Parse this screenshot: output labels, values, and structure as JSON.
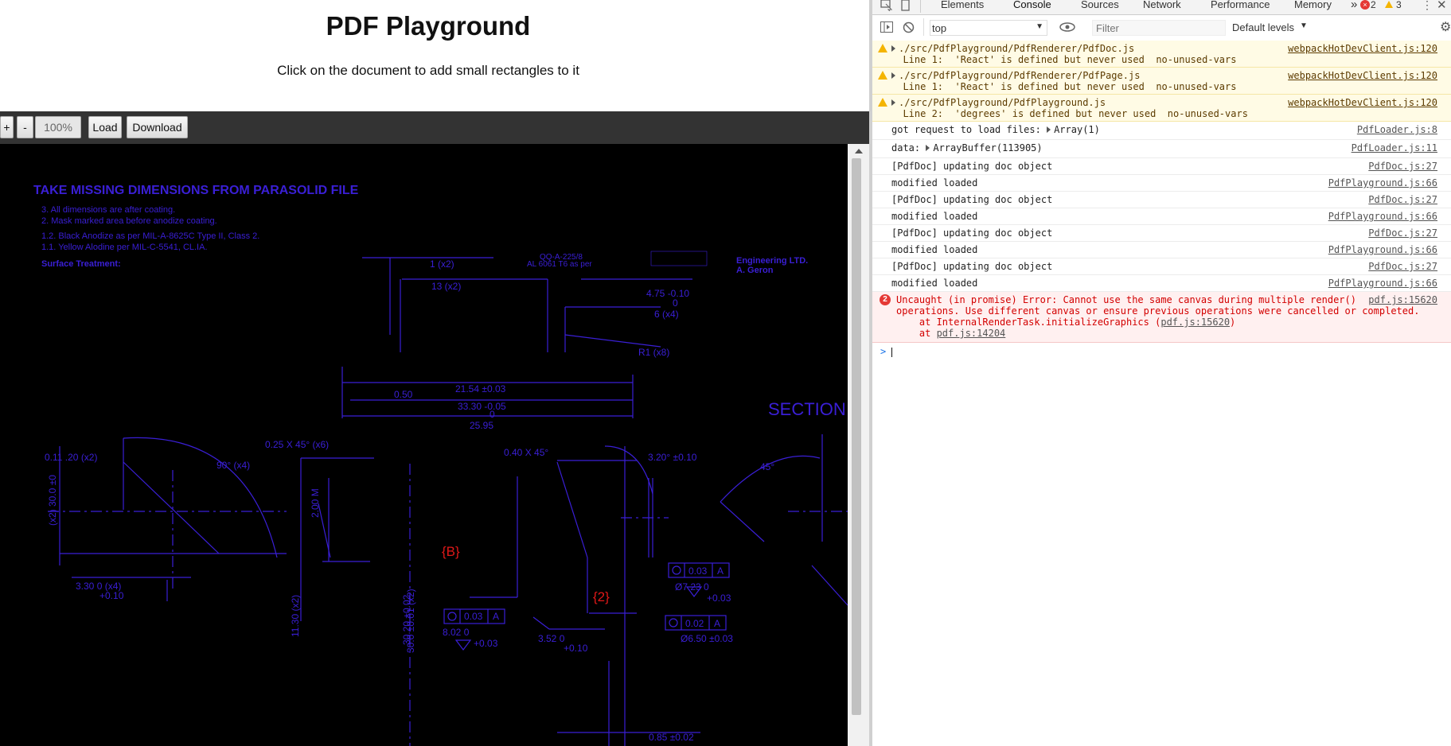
{
  "app": {
    "title": "PDF Playground",
    "subtitle": "Click on the document to add small rectangles to it",
    "toolbar": {
      "zoom_in": "+",
      "zoom_out": "-",
      "zoom_level": "100%",
      "load": "Load",
      "download": "Download"
    },
    "drawing": {
      "notes_title": "TAKE MISSING DIMENSIONS FROM PARASOLID FILE",
      "note_3": "3. All dimensions are after coating.",
      "note_2": "2. Mask marked area before anodize coating.",
      "note_1b": "1.2. Black Anodize as per MIL-A-8625C Type II, Class 2.",
      "note_1a": "1.1. Yellow Alodine per MIL-C-5541, CL.IA.",
      "surface": "Surface Treatment:",
      "material_1": "AL 6061 T6 as per",
      "material_2": "QQ-A-225/8",
      "company_1": "Engineering LTD.",
      "company_2": "A. Geron",
      "dim_1x2": "1 (x2)",
      "dim_13x2": "13 (x2)",
      "dim_475": "4.75 -0.10",
      "dim_475b": "0",
      "dim_6x4": "6 (x4)",
      "dim_r1x8": "R1 (x8)",
      "dim_050": "0.50",
      "dim_2154": "21.54 ±0.03",
      "dim_3330": "33.30 -0.05",
      "dim_3330b": "0",
      "dim_2595": "25.95",
      "section": "SECTION",
      "dim_011": "0.11 .20 (x2)",
      "dim_025": "0.25 X 45° (x6)",
      "dim_90": "90° (x4)",
      "dim_040": "0.40 X 45°",
      "dim_320": "3.20° ±0.10",
      "dim_45": "45°",
      "dim_200": "2.00 M",
      "dim_3010": "30.0 ±0.01 (x2)",
      "label_b": "{B}",
      "label_2": "{2}",
      "fcf_1": "0.03",
      "fcf_a": "A",
      "fcf_2": "0.02",
      "dim_723": "Ø7.23 0",
      "dim_003": "+0.03",
      "dim_650": "Ø6.50 ±0.03",
      "dim_802": "8.02 0",
      "dim_003b": "+0.03",
      "dim_330": "3.30   0   (x4)",
      "dim_010": "+0.10",
      "dim_352": "3.52   0",
      "dim_010b": "+0.10",
      "dim_085": "0.85 ±0.02",
      "dim_1130": "11.30 (x2)",
      "dim_302": "30.20 ±0.02",
      "dim_mid": "(x2) 30.0 ±0"
    }
  },
  "devtools": {
    "tabs": [
      "Elements",
      "Console",
      "Sources",
      "Network",
      "Performance",
      "Memory"
    ],
    "active_tab": "Console",
    "more_tabs": "»",
    "error_count": "2",
    "warning_count": "3",
    "context": "top",
    "filter_placeholder": "Filter",
    "levels": "Default levels",
    "rows": [
      {
        "type": "warn",
        "msg": "./src/PdfPlayground/PdfRenderer/PdfDoc.js\n  Line 1:  'React' is defined but never used  no-unused-vars",
        "src": "webpackHotDevClient.js:120"
      },
      {
        "type": "warn",
        "msg": "./src/PdfPlayground/PdfRenderer/PdfPage.js\n  Line 1:  'React' is defined but never used  no-unused-vars",
        "src": "webpackHotDevClient.js:120"
      },
      {
        "type": "warn",
        "msg": "./src/PdfPlayground/PdfPlayground.js\n  Line 2:  'degrees' is defined but never used  no-unused-vars",
        "src": "webpackHotDevClient.js:120"
      },
      {
        "type": "log",
        "msg": "got request to load files: ",
        "obj": "Array(1)",
        "src": "PdfLoader.js:8"
      },
      {
        "type": "log",
        "msg": "data: ",
        "obj": "ArrayBuffer(113905)",
        "src": "PdfLoader.js:11"
      },
      {
        "type": "log",
        "msg": "[PdfDoc] updating doc object",
        "src": "PdfDoc.js:27"
      },
      {
        "type": "log",
        "msg": "modified loaded",
        "src": "PdfPlayground.js:66"
      },
      {
        "type": "log",
        "msg": "[PdfDoc] updating doc object",
        "src": "PdfDoc.js:27"
      },
      {
        "type": "log",
        "msg": "modified loaded",
        "src": "PdfPlayground.js:66"
      },
      {
        "type": "log",
        "msg": "[PdfDoc] updating doc object",
        "src": "PdfDoc.js:27"
      },
      {
        "type": "log",
        "msg": "modified loaded",
        "src": "PdfPlayground.js:66"
      },
      {
        "type": "log",
        "msg": "[PdfDoc] updating doc object",
        "src": "PdfDoc.js:27"
      },
      {
        "type": "log",
        "msg": "modified loaded",
        "src": "PdfPlayground.js:66"
      }
    ],
    "error": {
      "line1": "Uncaught (in promise) Error: Cannot use the same canvas during multiple render()",
      "line2": "operations. Use different canvas or ensure previous operations were cancelled or completed.",
      "line3_prefix": "    at InternalRenderTask.initializeGraphics (",
      "line3_link": "pdf.js:15620",
      "line3_suffix": ")",
      "line4_prefix": "    at ",
      "line4_link": "pdf.js:14204",
      "src": "pdf.js:15620",
      "count": "2"
    },
    "prompt": ">"
  }
}
